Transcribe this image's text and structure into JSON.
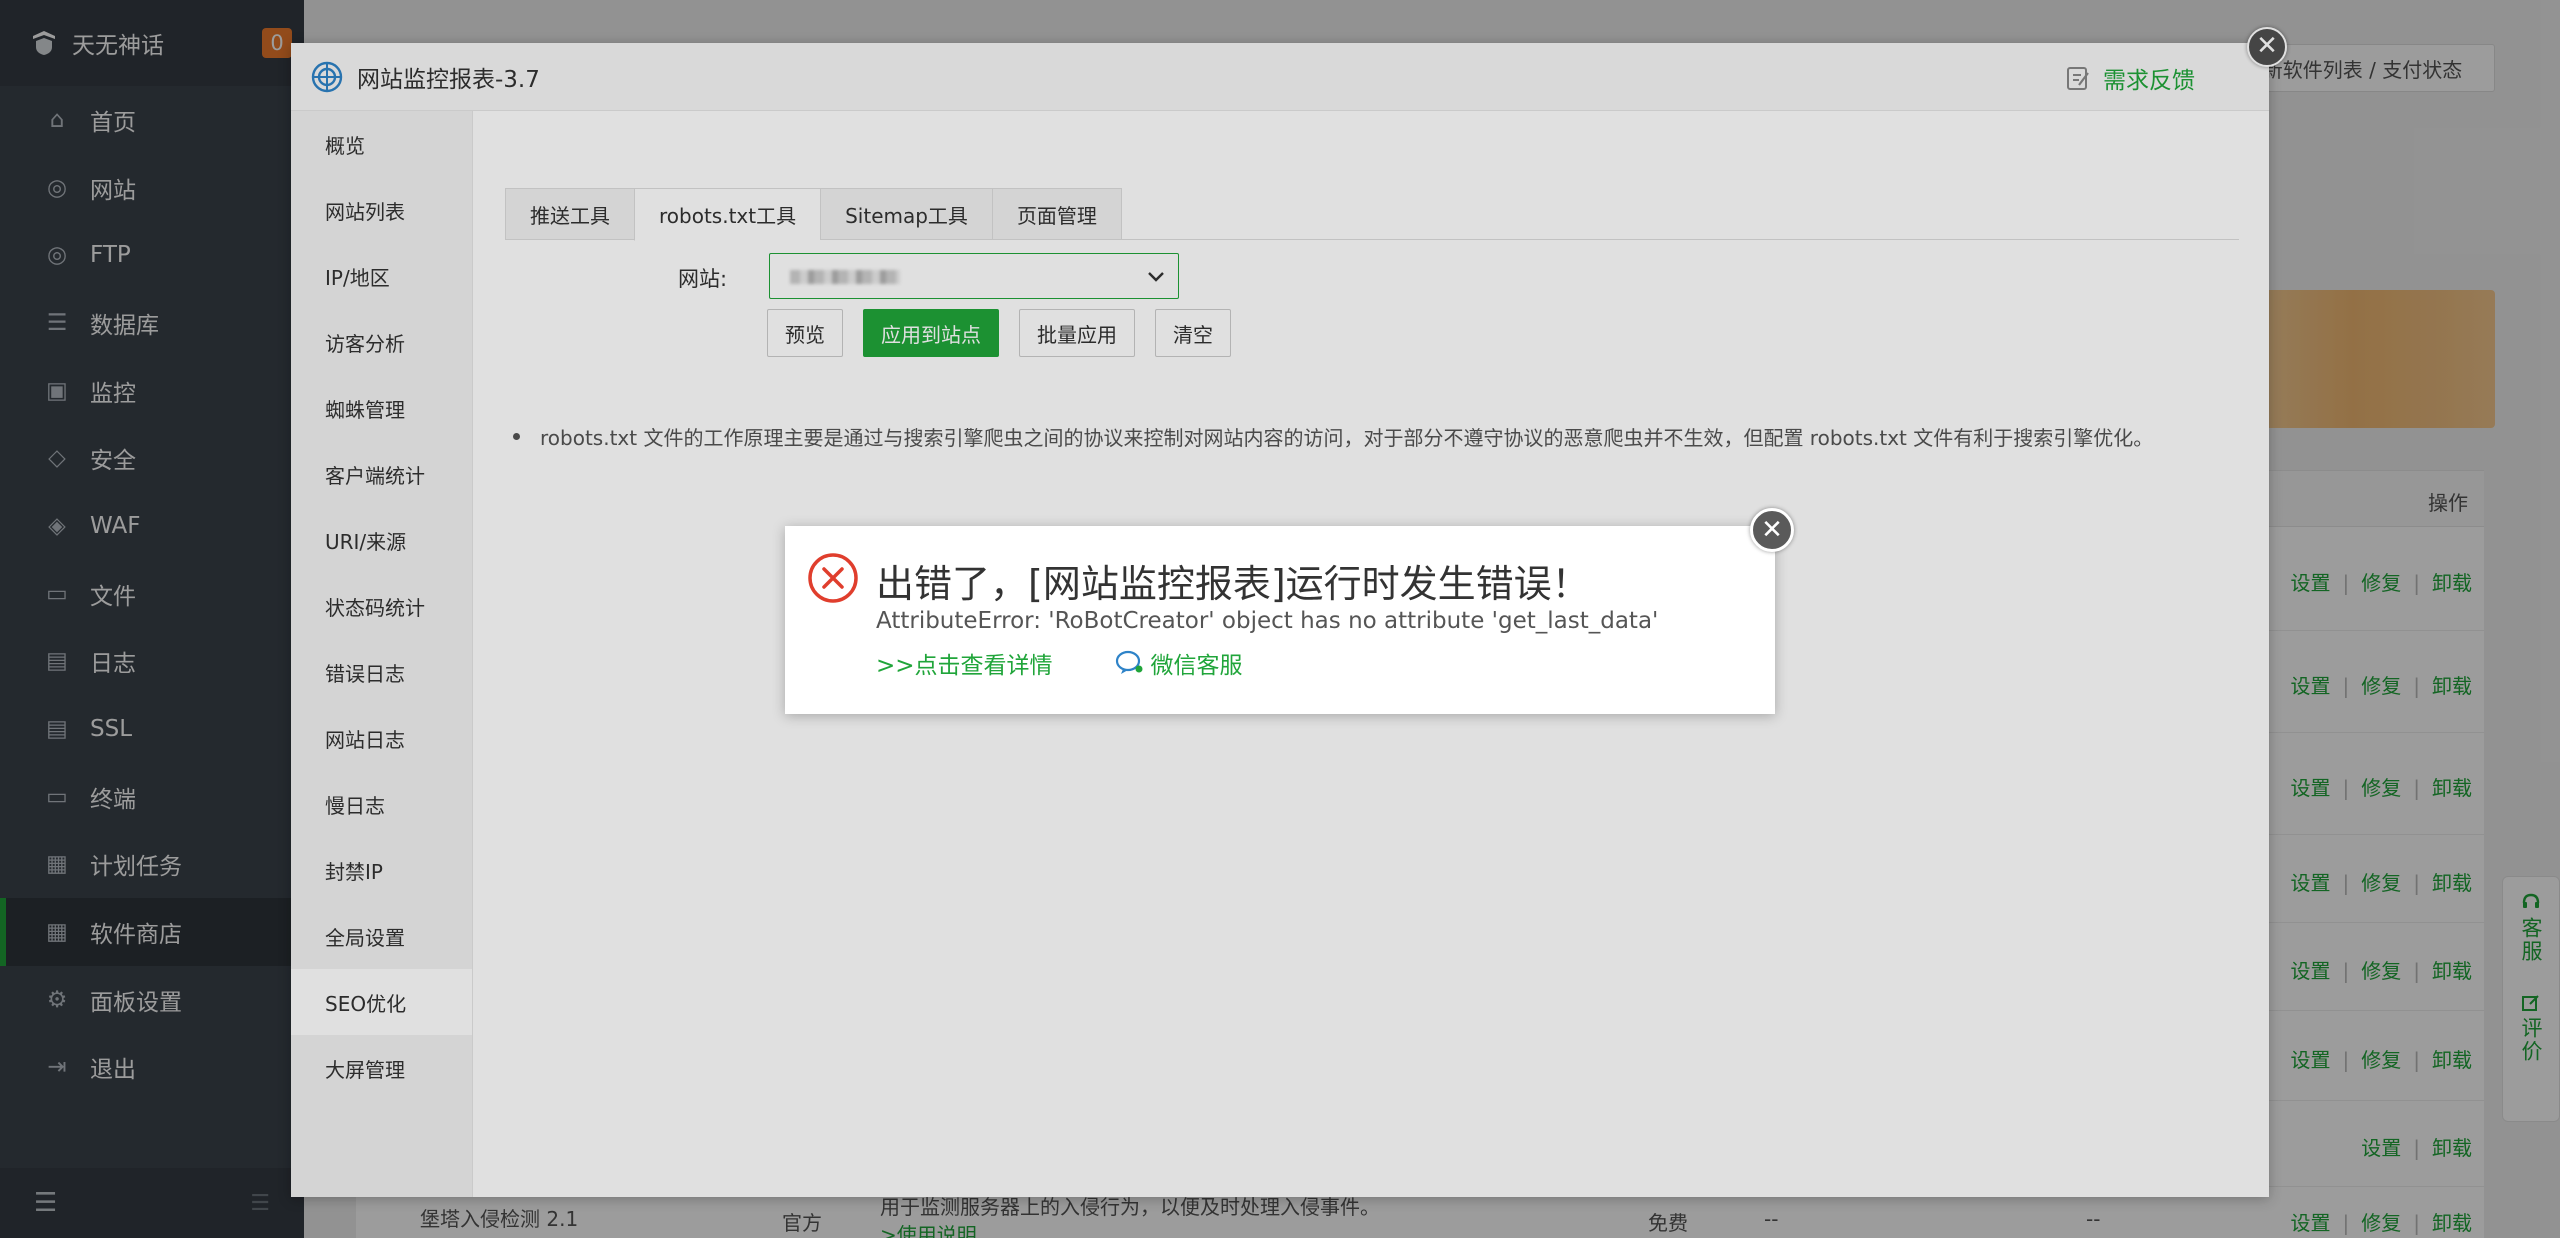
{
  "sidebar": {
    "brand": "天无神话",
    "badge": "0",
    "items": [
      {
        "label": "首页",
        "icon": "home-icon"
      },
      {
        "label": "网站",
        "icon": "globe-icon"
      },
      {
        "label": "FTP",
        "icon": "ftp-icon"
      },
      {
        "label": "数据库",
        "icon": "database-icon"
      },
      {
        "label": "监控",
        "icon": "monitor-icon"
      },
      {
        "label": "安全",
        "icon": "shield-icon"
      },
      {
        "label": "WAF",
        "icon": "waf-icon"
      },
      {
        "label": "文件",
        "icon": "folder-icon"
      },
      {
        "label": "日志",
        "icon": "log-icon"
      },
      {
        "label": "SSL",
        "icon": "ssl-icon"
      },
      {
        "label": "终端",
        "icon": "terminal-icon"
      },
      {
        "label": "计划任务",
        "icon": "calendar-icon"
      },
      {
        "label": "软件商店",
        "icon": "grid-icon"
      },
      {
        "label": "面板设置",
        "icon": "gear-icon"
      },
      {
        "label": "退出",
        "icon": "logout-icon"
      }
    ],
    "active_index": 12
  },
  "background": {
    "top_button": "新软件列表 / 支付状态",
    "table_header_ops": "操作",
    "ops": {
      "settings": "设置",
      "repair": "修复",
      "uninstall": "卸载"
    },
    "last_row": {
      "name": "堡塔入侵检测 2.1",
      "type": "官方",
      "desc": "用于监测服务器上的入侵行为，以便及时处理入侵事件。",
      "link": ">使用说明",
      "price": "免费",
      "expire": "--",
      "extra": "--"
    },
    "feedback_tab": {
      "service": "客服",
      "review": "评价"
    }
  },
  "plugin": {
    "title": "网站监控报表-3.7",
    "feedback": "需求反馈",
    "nav": [
      "概览",
      "网站列表",
      "IP/地区",
      "访客分析",
      "蜘蛛管理",
      "客户端统计",
      "URI/来源",
      "状态码统计",
      "错误日志",
      "网站日志",
      "慢日志",
      "封禁IP",
      "全局设置",
      "SEO优化",
      "大屏管理"
    ],
    "nav_active": 13,
    "tabs": [
      "推送工具",
      "robots.txt工具",
      "Sitemap工具",
      "页面管理"
    ],
    "tab_active": 1,
    "site_label": "网站:",
    "buttons": {
      "preview": "预览",
      "apply": "应用到站点",
      "batch": "批量应用",
      "clear": "清空"
    },
    "note": "robots.txt 文件的工作原理主要是通过与搜索引擎爬虫之间的协议来控制对网站内容的访问，对于部分不遵守协议的恶意爬虫并不生效，但配置 robots.txt 文件有利于搜索引擎优化。"
  },
  "error": {
    "title": "出错了，[网站监控报表]运行时发生错误！",
    "message": "AttributeError: 'RoBotCreator' object has no attribute 'get_last_data'",
    "details_link": ">>点击查看详情",
    "wechat": "微信客服"
  },
  "colors": {
    "accent": "#20a53a",
    "sidebar": "#3c444d",
    "badge": "#ef7b2d",
    "error": "#e03e2d"
  }
}
